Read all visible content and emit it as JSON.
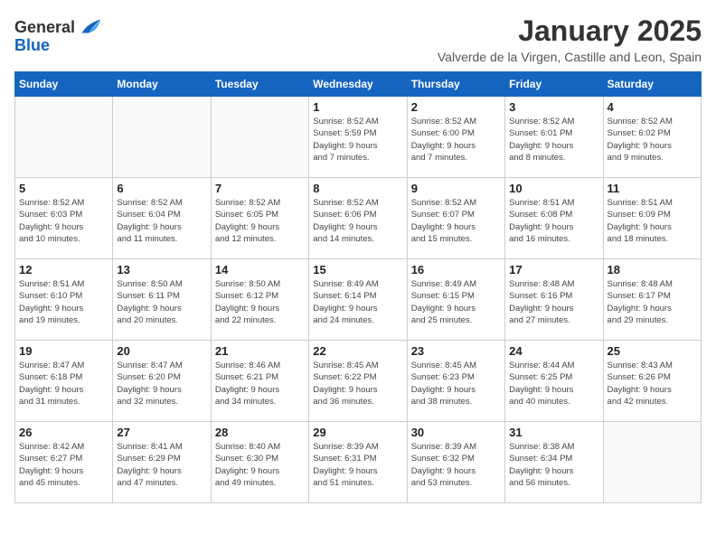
{
  "header": {
    "logo_general": "General",
    "logo_blue": "Blue",
    "month_title": "January 2025",
    "location": "Valverde de la Virgen, Castille and Leon, Spain"
  },
  "days_of_week": [
    "Sunday",
    "Monday",
    "Tuesday",
    "Wednesday",
    "Thursday",
    "Friday",
    "Saturday"
  ],
  "weeks": [
    [
      {
        "day": "",
        "info": ""
      },
      {
        "day": "",
        "info": ""
      },
      {
        "day": "",
        "info": ""
      },
      {
        "day": "1",
        "info": "Sunrise: 8:52 AM\nSunset: 5:59 PM\nDaylight: 9 hours\nand 7 minutes."
      },
      {
        "day": "2",
        "info": "Sunrise: 8:52 AM\nSunset: 6:00 PM\nDaylight: 9 hours\nand 7 minutes."
      },
      {
        "day": "3",
        "info": "Sunrise: 8:52 AM\nSunset: 6:01 PM\nDaylight: 9 hours\nand 8 minutes."
      },
      {
        "day": "4",
        "info": "Sunrise: 8:52 AM\nSunset: 6:02 PM\nDaylight: 9 hours\nand 9 minutes."
      }
    ],
    [
      {
        "day": "5",
        "info": "Sunrise: 8:52 AM\nSunset: 6:03 PM\nDaylight: 9 hours\nand 10 minutes."
      },
      {
        "day": "6",
        "info": "Sunrise: 8:52 AM\nSunset: 6:04 PM\nDaylight: 9 hours\nand 11 minutes."
      },
      {
        "day": "7",
        "info": "Sunrise: 8:52 AM\nSunset: 6:05 PM\nDaylight: 9 hours\nand 12 minutes."
      },
      {
        "day": "8",
        "info": "Sunrise: 8:52 AM\nSunset: 6:06 PM\nDaylight: 9 hours\nand 14 minutes."
      },
      {
        "day": "9",
        "info": "Sunrise: 8:52 AM\nSunset: 6:07 PM\nDaylight: 9 hours\nand 15 minutes."
      },
      {
        "day": "10",
        "info": "Sunrise: 8:51 AM\nSunset: 6:08 PM\nDaylight: 9 hours\nand 16 minutes."
      },
      {
        "day": "11",
        "info": "Sunrise: 8:51 AM\nSunset: 6:09 PM\nDaylight: 9 hours\nand 18 minutes."
      }
    ],
    [
      {
        "day": "12",
        "info": "Sunrise: 8:51 AM\nSunset: 6:10 PM\nDaylight: 9 hours\nand 19 minutes."
      },
      {
        "day": "13",
        "info": "Sunrise: 8:50 AM\nSunset: 6:11 PM\nDaylight: 9 hours\nand 20 minutes."
      },
      {
        "day": "14",
        "info": "Sunrise: 8:50 AM\nSunset: 6:12 PM\nDaylight: 9 hours\nand 22 minutes."
      },
      {
        "day": "15",
        "info": "Sunrise: 8:49 AM\nSunset: 6:14 PM\nDaylight: 9 hours\nand 24 minutes."
      },
      {
        "day": "16",
        "info": "Sunrise: 8:49 AM\nSunset: 6:15 PM\nDaylight: 9 hours\nand 25 minutes."
      },
      {
        "day": "17",
        "info": "Sunrise: 8:48 AM\nSunset: 6:16 PM\nDaylight: 9 hours\nand 27 minutes."
      },
      {
        "day": "18",
        "info": "Sunrise: 8:48 AM\nSunset: 6:17 PM\nDaylight: 9 hours\nand 29 minutes."
      }
    ],
    [
      {
        "day": "19",
        "info": "Sunrise: 8:47 AM\nSunset: 6:18 PM\nDaylight: 9 hours\nand 31 minutes."
      },
      {
        "day": "20",
        "info": "Sunrise: 8:47 AM\nSunset: 6:20 PM\nDaylight: 9 hours\nand 32 minutes."
      },
      {
        "day": "21",
        "info": "Sunrise: 8:46 AM\nSunset: 6:21 PM\nDaylight: 9 hours\nand 34 minutes."
      },
      {
        "day": "22",
        "info": "Sunrise: 8:45 AM\nSunset: 6:22 PM\nDaylight: 9 hours\nand 36 minutes."
      },
      {
        "day": "23",
        "info": "Sunrise: 8:45 AM\nSunset: 6:23 PM\nDaylight: 9 hours\nand 38 minutes."
      },
      {
        "day": "24",
        "info": "Sunrise: 8:44 AM\nSunset: 6:25 PM\nDaylight: 9 hours\nand 40 minutes."
      },
      {
        "day": "25",
        "info": "Sunrise: 8:43 AM\nSunset: 6:26 PM\nDaylight: 9 hours\nand 42 minutes."
      }
    ],
    [
      {
        "day": "26",
        "info": "Sunrise: 8:42 AM\nSunset: 6:27 PM\nDaylight: 9 hours\nand 45 minutes."
      },
      {
        "day": "27",
        "info": "Sunrise: 8:41 AM\nSunset: 6:29 PM\nDaylight: 9 hours\nand 47 minutes."
      },
      {
        "day": "28",
        "info": "Sunrise: 8:40 AM\nSunset: 6:30 PM\nDaylight: 9 hours\nand 49 minutes."
      },
      {
        "day": "29",
        "info": "Sunrise: 8:39 AM\nSunset: 6:31 PM\nDaylight: 9 hours\nand 51 minutes."
      },
      {
        "day": "30",
        "info": "Sunrise: 8:39 AM\nSunset: 6:32 PM\nDaylight: 9 hours\nand 53 minutes."
      },
      {
        "day": "31",
        "info": "Sunrise: 8:38 AM\nSunset: 6:34 PM\nDaylight: 9 hours\nand 56 minutes."
      },
      {
        "day": "",
        "info": ""
      }
    ]
  ]
}
